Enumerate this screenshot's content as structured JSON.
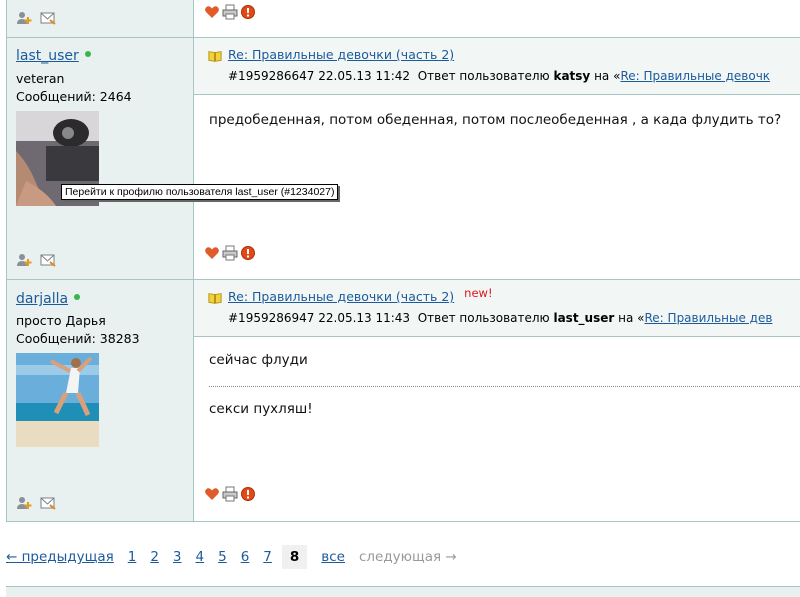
{
  "posts": [
    {
      "username": "last_user",
      "rank": "veteran",
      "posts_label": "Сообщений: 2464",
      "subject": "Re: Правильные девочки (часть 2)",
      "post_id": "#1959286647",
      "datetime": "22.05.13 11:42",
      "reply_prefix": "Ответ пользователю",
      "reply_to": "katsy",
      "reply_on": "на «",
      "reply_link": "Re: Правильные девочк",
      "body": "предобеденная, потом обеденная, потом послеобеденная , а када флудить то?"
    },
    {
      "username": "darjalla",
      "rank": "просто Дарья",
      "posts_label": "Сообщений: 38283",
      "subject": "Re: Правильные девочки (часть 2)",
      "new_label": "new!",
      "post_id": "#1959286947",
      "datetime": "22.05.13 11:43",
      "reply_prefix": "Ответ пользователю",
      "reply_to": "last_user",
      "reply_on": "на «",
      "reply_link": "Re: Правильные дев",
      "body_quote": "сейчас флуди",
      "body": "секси пухляш!"
    }
  ],
  "tooltip": "Перейти к профилю пользователя last_user (#1234027)",
  "pagination": {
    "prev": "← предыдущая",
    "pages": [
      "1",
      "2",
      "3",
      "4",
      "5",
      "6",
      "7"
    ],
    "current": "8",
    "all": "все",
    "next": "следующая →"
  },
  "colors": {
    "link": "#1c5a9c",
    "sidebar_bg": "#e8f1f0",
    "border": "#a5c6c4",
    "new_badge": "#e0151b",
    "online": "#39b54a"
  }
}
